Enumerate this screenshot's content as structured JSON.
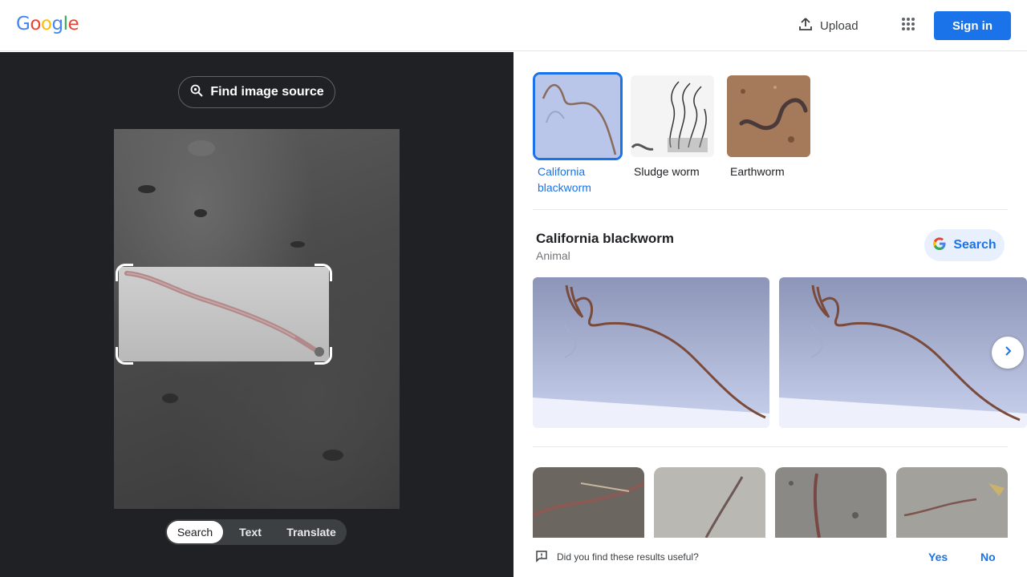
{
  "header": {
    "logo_letters": [
      "G",
      "o",
      "o",
      "g",
      "l",
      "e"
    ],
    "logo_colors": [
      "#4285f4",
      "#ea4335",
      "#fbbc05",
      "#4285f4",
      "#34a853",
      "#ea4335"
    ],
    "upload_label": "Upload",
    "apps_icon": "apps-grid-icon",
    "signin_label": "Sign in"
  },
  "lens": {
    "find_source_label": "Find image source",
    "modes": [
      "Search",
      "Text",
      "Translate"
    ],
    "active_mode": "Search"
  },
  "results": {
    "chips": [
      {
        "label": "California blackworm",
        "selected": true
      },
      {
        "label": "Sludge worm",
        "selected": false
      },
      {
        "label": "Earthworm",
        "selected": false
      }
    ],
    "knowledge_panel": {
      "title": "California blackworm",
      "subtitle": "Animal",
      "search_label": "Search"
    },
    "feedback": {
      "question": "Did you find these results useful?",
      "yes": "Yes",
      "no": "No"
    }
  },
  "colors": {
    "accent": "#1a73e8",
    "dark_panel": "#202124"
  }
}
